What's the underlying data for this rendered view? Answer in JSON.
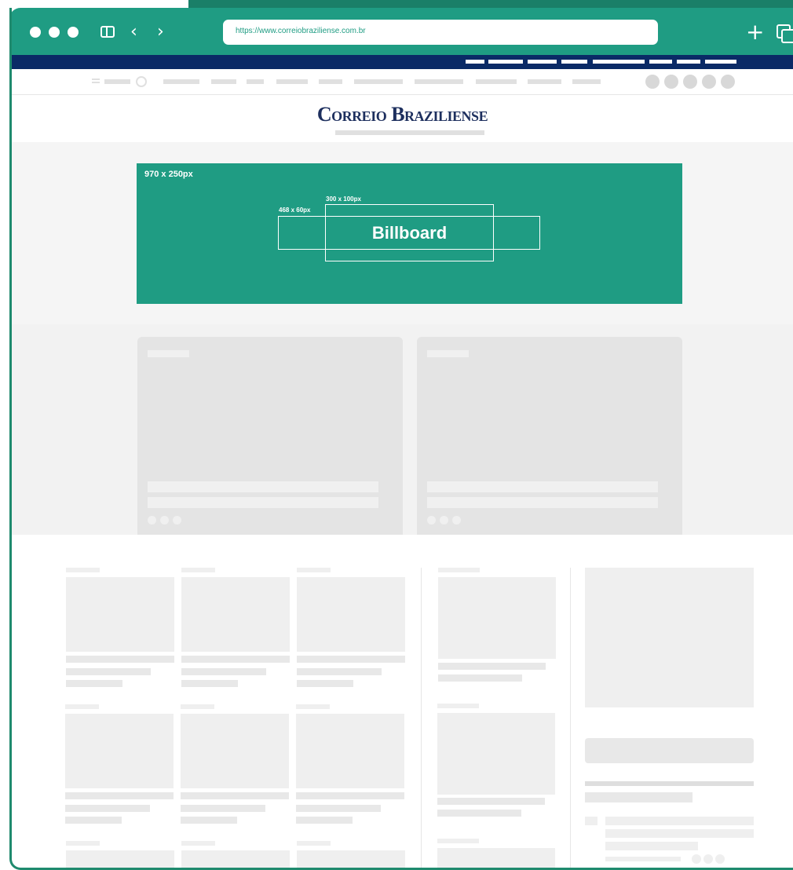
{
  "browser": {
    "url": "https://www.correiobraziliense.com.br",
    "icons": [
      "window-dot-icon",
      "sidebar-icon",
      "back-arrow-icon",
      "forward-arrow-icon",
      "new-tab-plus-icon",
      "tabs-copy-icon"
    ],
    "back_glyph": "‹",
    "forward_glyph": "›",
    "plus_glyph": "+"
  },
  "site": {
    "logo": "Correio Braziliense"
  },
  "billboard": {
    "size_label": "970 x 250px",
    "inner_label_small": "468 x 60px",
    "inner_label_medium": "300 x 100px",
    "title": "Billboard",
    "color": "#1f9c83"
  },
  "colors": {
    "frame_accent": "#1f9c83",
    "top_nav": "#0a2a66",
    "placeholder": "#e4e4e4"
  }
}
